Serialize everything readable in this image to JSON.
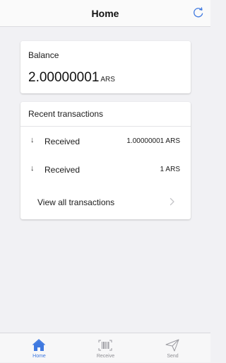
{
  "header": {
    "title": "Home",
    "refresh_icon": "refresh-icon",
    "accent_color": "#3f79e0"
  },
  "balance": {
    "label": "Balance",
    "amount": "2.00000001",
    "currency": "ARS"
  },
  "transactions": {
    "title": "Recent transactions",
    "items": [
      {
        "direction_icon": "↓",
        "label": "Received",
        "amount": "1.00000001 ARS"
      },
      {
        "direction_icon": "↓",
        "label": "Received",
        "amount": "1 ARS"
      }
    ],
    "view_all_label": "View all transactions"
  },
  "tabbar": {
    "tabs": [
      {
        "label": "Home",
        "icon": "home-icon",
        "active": true
      },
      {
        "label": "Receive",
        "icon": "barcode-icon",
        "active": false
      },
      {
        "label": "Send",
        "icon": "paper-plane-icon",
        "active": false
      }
    ]
  }
}
